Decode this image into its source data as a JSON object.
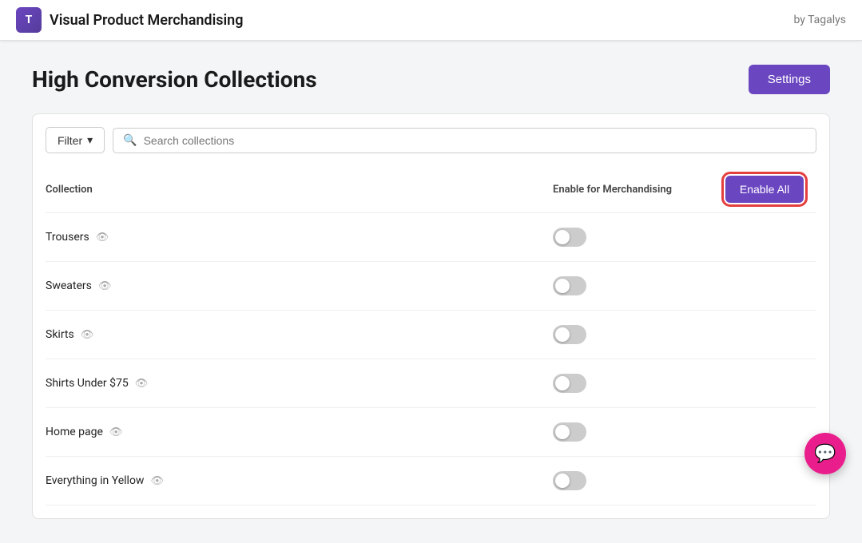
{
  "header": {
    "logo_text": "T",
    "title": "Visual Product Merchandising",
    "byline": "by Tagalys"
  },
  "page": {
    "title": "High Conversion Collections",
    "settings_label": "Settings"
  },
  "filter": {
    "filter_label": "Filter",
    "search_placeholder": "Search collections"
  },
  "table": {
    "col_collection": "Collection",
    "col_enable": "Enable for Merchandising",
    "enable_all_label": "Enable All"
  },
  "rows": [
    {
      "name": "Trousers",
      "enabled": false
    },
    {
      "name": "Sweaters",
      "enabled": false
    },
    {
      "name": "Skirts",
      "enabled": false
    },
    {
      "name": "Shirts Under $75",
      "enabled": false
    },
    {
      "name": "Home page",
      "enabled": false
    },
    {
      "name": "Everything in Yellow",
      "enabled": false
    }
  ]
}
